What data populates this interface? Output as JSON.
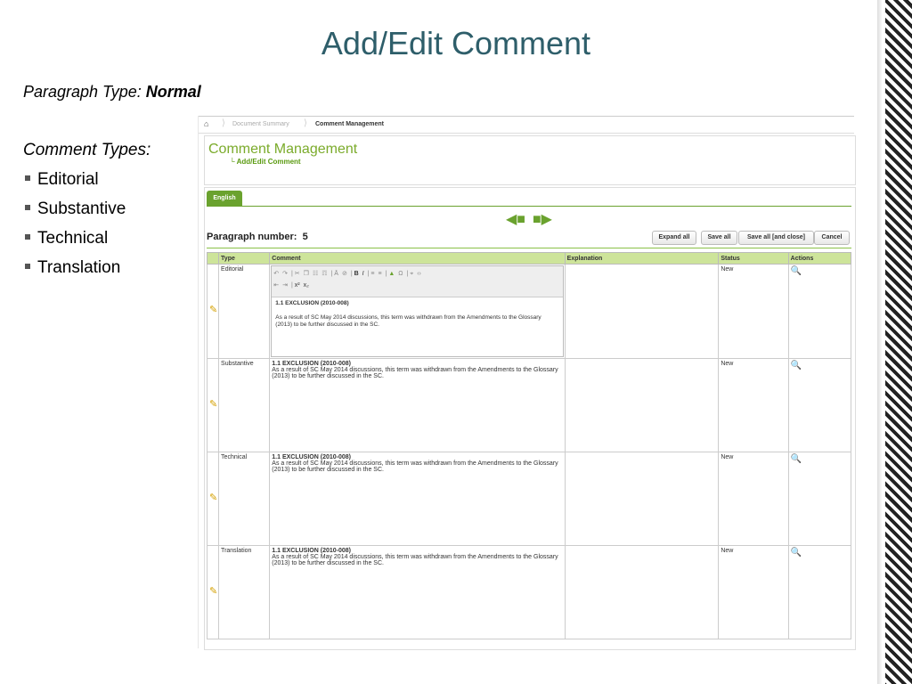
{
  "slide": {
    "title": "Add/Edit Comment",
    "paragraph_type_label": "Paragraph Type: ",
    "paragraph_type_value": "Normal",
    "comment_types_label": "Comment Types:",
    "comment_types": [
      "Editorial",
      "Substantive",
      "Technical",
      "Translation"
    ]
  },
  "breadcrumb": {
    "items": [
      "Document Summary",
      "Comment Management"
    ]
  },
  "header": {
    "title": "Comment Management",
    "subtitle": "Add/Edit Comment"
  },
  "tabs": [
    {
      "label": "English"
    }
  ],
  "paragraph": {
    "label": "Paragraph number:",
    "number": "5"
  },
  "buttons": {
    "expand_all": "Expand all",
    "save_all": "Save all",
    "save_all_close": "Save all [and close]",
    "cancel": "Cancel"
  },
  "table": {
    "headers": [
      "Type",
      "Comment",
      "Explanation",
      "Status",
      "Actions"
    ],
    "rows": [
      {
        "type": "Editorial",
        "comment_title": "1.1 EXCLUSION (2010-008)",
        "comment_text": "As a result of SC May 2014 discussions, this term was withdrawn from the Amendments to the Glossary (2013) to be further discussed in the SC.",
        "explanation": "",
        "status": "New"
      },
      {
        "type": "Substantive",
        "comment_title": "1.1 EXCLUSION (2010-008)",
        "comment_text": "As a result of SC May 2014 discussions, this term was withdrawn from the Amendments to the Glossary (2013) to be further discussed in the SC.",
        "explanation": "",
        "status": "New"
      },
      {
        "type": "Technical",
        "comment_title": "1.1 EXCLUSION (2010-008)",
        "comment_text": "As a result of SC May 2014 discussions, this term was withdrawn from the Amendments to the Glossary (2013) to be further discussed in the SC.",
        "explanation": "",
        "status": "New"
      },
      {
        "type": "Translation",
        "comment_title": "1.1 EXCLUSION (2010-008)",
        "comment_text": "As a result of SC May 2014 discussions, this term was withdrawn from the Amendments to the Glossary (2013) to be further discussed in the SC.",
        "explanation": "",
        "status": "New"
      }
    ]
  },
  "colors": {
    "title": "#2e5e6a",
    "accent_green": "#6aa22e",
    "header_row": "#cde49a"
  },
  "icons": {
    "home": "home-icon",
    "edit": "pencil-icon",
    "view": "magnifier-icon",
    "prev": "arrow-left-icon",
    "next": "arrow-right-icon"
  }
}
